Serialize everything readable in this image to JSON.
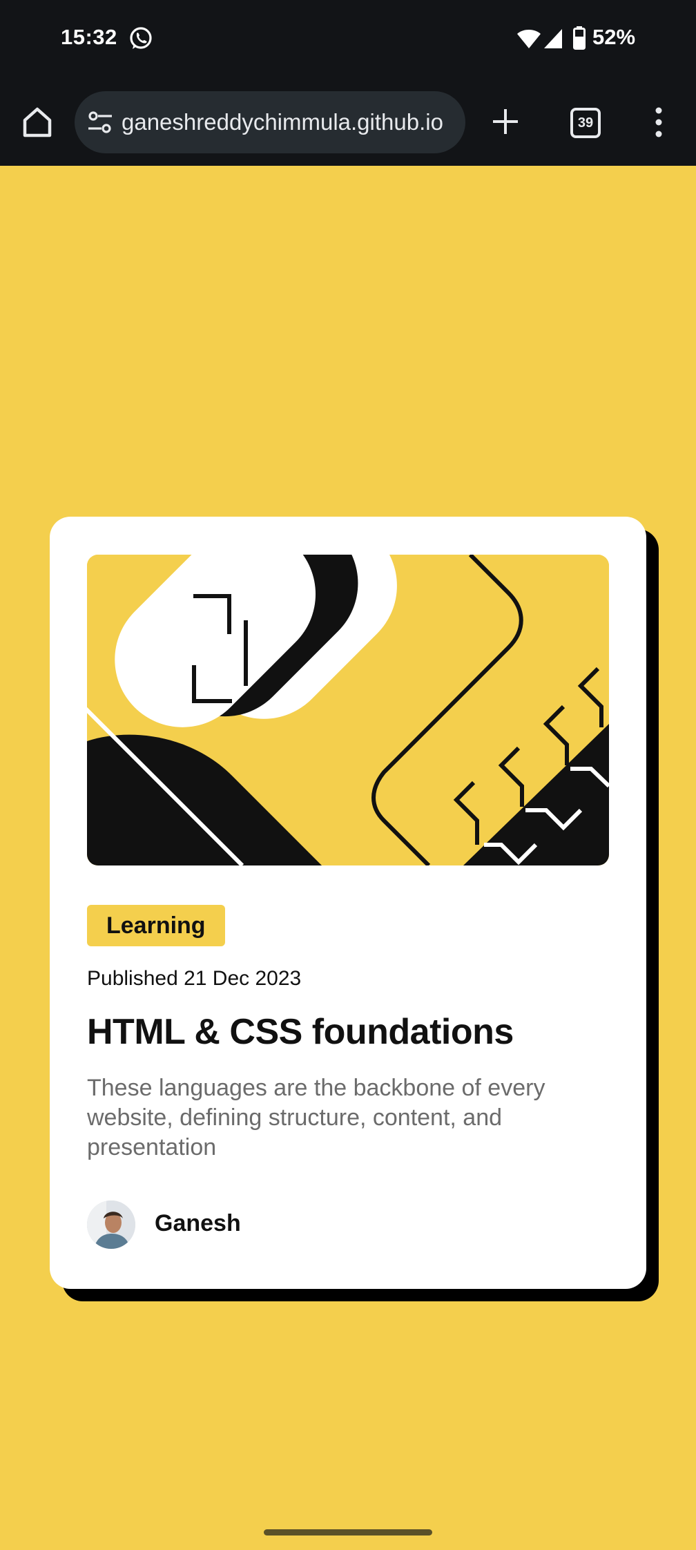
{
  "status_bar": {
    "time": "15:32",
    "battery_percent": "52%",
    "icons": [
      "whatsapp-icon",
      "wifi-icon",
      "signal-icon",
      "battery-icon"
    ]
  },
  "browser": {
    "url": "ganeshreddychimmula.github.io",
    "tab_count": "39",
    "icons": [
      "home-icon",
      "tune-icon",
      "plus-icon",
      "tabs-icon",
      "more-vert-icon"
    ]
  },
  "card": {
    "tag": "Learning",
    "published": "Published 21 Dec 2023",
    "title": "HTML & CSS foundations",
    "description": "These languages are the backbone of every website, defining structure, content, and presentation",
    "author": "Ganesh"
  },
  "colors": {
    "background": "#f4cf4d",
    "card": "#ffffff",
    "text": "#111111",
    "muted_text": "#6b6b6b",
    "status_bar": "#121417"
  }
}
